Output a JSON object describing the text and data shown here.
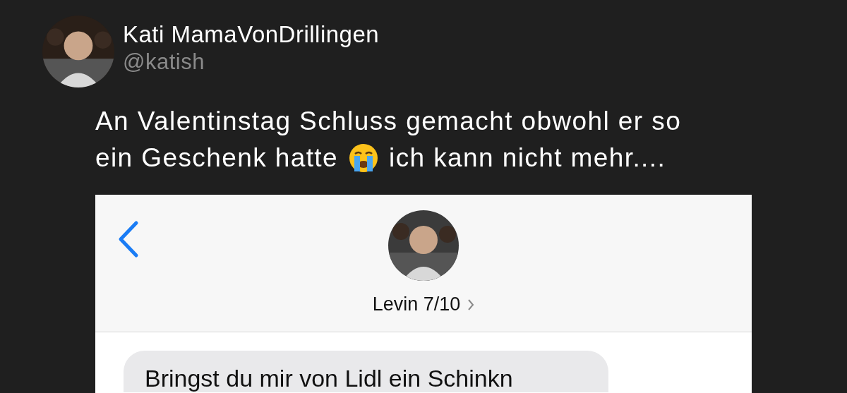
{
  "author": {
    "name": "Kati MamaVonDrillingen",
    "handle": "@katish"
  },
  "tweet": {
    "line_1": "An Valentinstag Schluss gemacht obwohl er so",
    "text_before_emoji": "ein Geschenk hatte",
    "text_after_emoji": "ich kann nicht mehr...."
  },
  "embedded_chat": {
    "contact_name": "Levin 7/10",
    "messages": [
      {
        "text": "Bringst du mir von Lidl ein Schinkn",
        "kind": "received"
      }
    ]
  }
}
